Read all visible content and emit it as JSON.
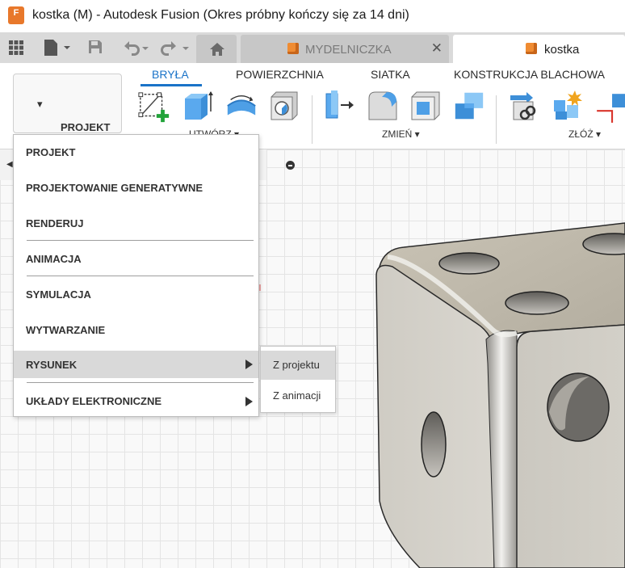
{
  "window": {
    "title": "kostka (M) - Autodesk Fusion (Okres próbny kończy się za 14 dni)",
    "logo_letter": "F"
  },
  "tabs": [
    {
      "label": "MYDELNICZKA",
      "active": false
    },
    {
      "label": "kostka",
      "active": true
    }
  ],
  "ribbon": {
    "workspace_button": "PROJEKT",
    "tabs": [
      "BRYŁA",
      "POWIERZCHNIA",
      "SIATKA",
      "KONSTRUKCJA BLACHOWA"
    ],
    "active_tab": "BRYŁA",
    "groups": [
      "UTWÓRZ",
      "ZMIEŃ",
      "ZŁÓŻ"
    ]
  },
  "menu": {
    "items": [
      {
        "label": "PROJEKT",
        "has_submenu": false
      },
      {
        "label": "PROJEKTOWANIE GENERATYWNE",
        "has_submenu": false
      },
      {
        "label": "RENDERUJ",
        "has_submenu": false
      },
      {
        "label": "ANIMACJA",
        "has_submenu": false
      },
      {
        "label": "SYMULACJA",
        "has_submenu": false
      },
      {
        "label": "WYTWARZANIE",
        "has_submenu": false
      },
      {
        "label": "RYSUNEK",
        "has_submenu": true,
        "highlighted": true
      },
      {
        "label": "UKŁADY ELEKTRONICZNE",
        "has_submenu": true
      }
    ],
    "submenu": [
      {
        "label": "Z projektu",
        "highlighted": true
      },
      {
        "label": "Z animacji"
      }
    ]
  },
  "colors": {
    "accent": "#1a73c8",
    "logo": "#e8782b",
    "model": "#d6d3cb"
  }
}
